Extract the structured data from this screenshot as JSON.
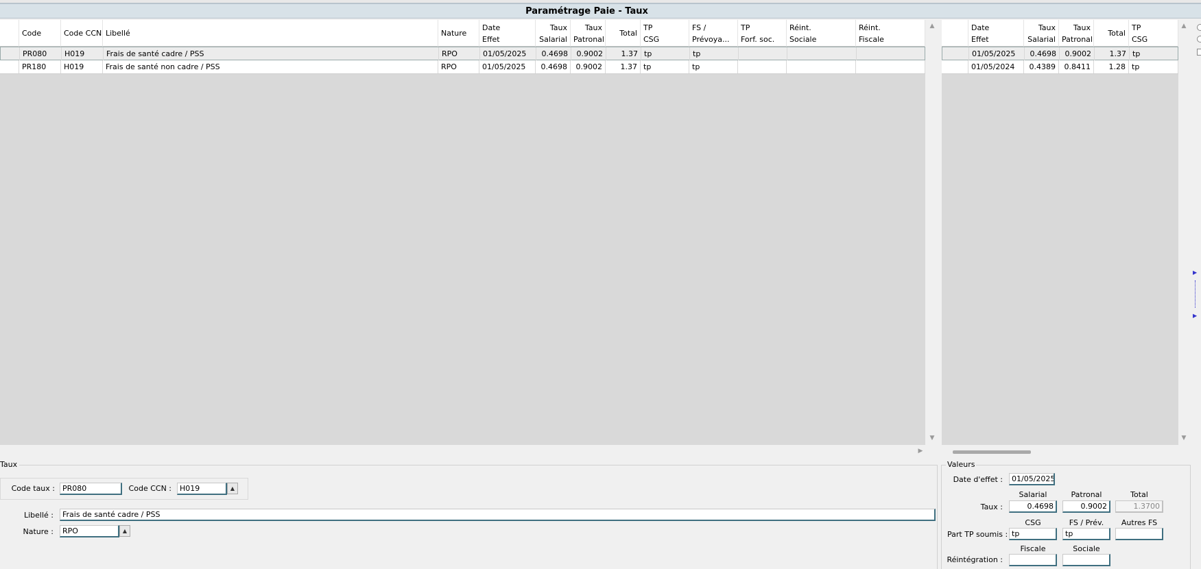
{
  "title": "Paramétrage Paie - Taux",
  "main_grid": {
    "headers": {
      "code": "Code",
      "code_ccn": "Code CCN",
      "libelle": "Libellé",
      "nature": "Nature",
      "date_effet_1": "Date",
      "date_effet_2": "Effet",
      "taux_sal_1": "Taux",
      "taux_sal_2": "Salarial",
      "taux_pat_1": "Taux",
      "taux_pat_2": "Patronal",
      "total": "Total",
      "tp_csg_1": "TP",
      "tp_csg_2": "CSG",
      "fs_prev_1": "FS /",
      "fs_prev_2": "Prévoya...",
      "tp_forf_1": "TP",
      "tp_forf_2": "Forf. soc.",
      "reint_soc_1": "Réint.",
      "reint_soc_2": "Sociale",
      "reint_fisc_1": "Réint.",
      "reint_fisc_2": "Fiscale"
    },
    "rows": [
      {
        "code": "PR080",
        "code_ccn": "H019",
        "libelle": "Frais de santé cadre / PSS",
        "nature": "RPO",
        "date_effet": "01/05/2025",
        "taux_salarial": "0.4698",
        "taux_patronal": "0.9002",
        "total": "1.37",
        "tp_csg": "tp",
        "fs_prev": "tp",
        "tp_forf": "",
        "reint_sociale": "",
        "reint_fiscale": ""
      },
      {
        "code": "PR180",
        "code_ccn": "H019",
        "libelle": "Frais de santé non cadre / PSS",
        "nature": "RPO",
        "date_effet": "01/05/2025",
        "taux_salarial": "0.4698",
        "taux_patronal": "0.9002",
        "total": "1.37",
        "tp_csg": "tp",
        "fs_prev": "tp",
        "tp_forf": "",
        "reint_sociale": "",
        "reint_fiscale": ""
      }
    ]
  },
  "history_grid": {
    "headers": {
      "date_effet_1": "Date",
      "date_effet_2": "Effet",
      "taux_sal_1": "Taux",
      "taux_sal_2": "Salarial",
      "taux_pat_1": "Taux",
      "taux_pat_2": "Patronal",
      "total": "Total",
      "tp_csg_1": "TP",
      "tp_csg_2": "CSG"
    },
    "rows": [
      {
        "date_effet": "01/05/2025",
        "taux_salarial": "0.4698",
        "taux_patronal": "0.9002",
        "total": "1.37",
        "tp_csg": "tp"
      },
      {
        "date_effet": "01/05/2024",
        "taux_salarial": "0.4389",
        "taux_patronal": "0.8411",
        "total": "1.28",
        "tp_csg": "tp"
      }
    ]
  },
  "taux_panel": {
    "legend": "Taux",
    "code_taux_label": "Code taux :",
    "code_taux_value": "PR080",
    "code_ccn_label": "Code CCN :",
    "code_ccn_value": "H019",
    "libelle_label": "Libellé :",
    "libelle_value": "Frais de santé cadre / PSS",
    "nature_label": "Nature :",
    "nature_value": "RPO"
  },
  "valeurs_panel": {
    "legend": "Valeurs",
    "date_effet_label": "Date d'effet :",
    "date_effet_value": "01/05/2025",
    "col_salarial": "Salarial",
    "col_patronal": "Patronal",
    "col_total": "Total",
    "taux_label": "Taux :",
    "taux_salarial": "0.4698",
    "taux_patronal": "0.9002",
    "taux_total": "1.3700",
    "col_csg": "CSG",
    "col_fs_prev": "FS / Prév.",
    "col_autres_fs": "Autres FS",
    "part_tp_label": "Part TP soumis :",
    "part_tp_csg": "tp",
    "part_tp_fs_prev": "tp",
    "part_tp_autres": "",
    "col_fiscale": "Fiscale",
    "col_sociale": "Sociale",
    "reint_label": "Réintégration :",
    "reint_fiscale": "",
    "reint_sociale": ""
  }
}
